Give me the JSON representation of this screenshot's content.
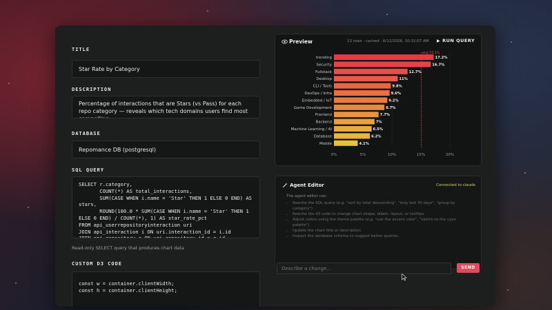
{
  "left": {
    "title_label": "TITLE",
    "title_value": "Star Rate by Category",
    "description_label": "DESCRIPTION",
    "description_value": "Percentage of interactions that are Stars (vs Pass) for each repo category — reveals which tech domains users find most compelling",
    "database_label": "DATABASE",
    "database_value": "Repomance DB (postgresql)",
    "sql_label": "SQL QUERY",
    "sql_value": "SELECT r.category,\n       COUNT(*) AS total_interactions,\n       SUM(CASE WHEN i.name = 'Star' THEN 1 ELSE 0 END) AS\nstars,\n       ROUND(100.0 * SUM(CASE WHEN i.name = 'Star' THEN 1\nELSE 0 END) / COUNT(*), 1) AS star_rate_pct\nFROM api_userrepositoryinteraction uri\nJOIN api_interaction i ON uri.interaction_id = i.id\nJOIN api_repository r ON uri.repository_id = r.id\nGROUP BY r.category\nHAVING COUNT(*) > 50",
    "sql_hint": "Read-only SELECT query that produces chart data",
    "d3_label": "CUSTOM D3 CODE",
    "d3_value": "const w = container.clientWidth;\nconst h = container.clientHeight;"
  },
  "preview": {
    "title": "Preview",
    "meta": "13 rows · cached · 6/12/2026, 10:32:07 AM",
    "run_label": "RUN QUERY"
  },
  "chart_data": {
    "type": "bar",
    "orientation": "horizontal",
    "categories": [
      "trending",
      "Security",
      "Fullstack",
      "Desktop",
      "CLI / Tools",
      "DevOps / Infra",
      "Embedded / IoT",
      "Game Development",
      "Frontend",
      "Backend",
      "Machine Learning / AI",
      "Database",
      "Mobile"
    ],
    "values": [
      17.2,
      16.7,
      12.7,
      11,
      9.8,
      9.6,
      9.2,
      8.7,
      7.7,
      7,
      6.5,
      6.2,
      4.1
    ],
    "value_labels": [
      "17.2%",
      "16.7%",
      "12.7%",
      "11%",
      "9.8%",
      "9.6%",
      "9.2%",
      "8.7%",
      "7.7%",
      "7%",
      "6.5%",
      "6.2%",
      "4.1%"
    ],
    "x_ticks": [
      "0%",
      "5%",
      "10%",
      "15%",
      "20%"
    ],
    "xlim": [
      0,
      20
    ],
    "reference_line": {
      "value": 15.1,
      "label": "avg 15.1%"
    },
    "colors": {
      "start": "#e8364a",
      "end": "#e8c23c",
      "reference": "#e14a5a"
    }
  },
  "agent": {
    "title": "Agent Editor",
    "status": "Connected to claude",
    "intro": "The agent editor can:",
    "items": [
      "Rewrite the SQL query (e.g. \"sort by total descending\", \"only last 30 days\", \"group by category\")",
      "Rewrite the d3 code to change chart shape, labels, layout, or tooltips",
      "Adjust colors using the theme palette (e.g. \"use the accent color\", \"switch to the cyan palette\")",
      "Update the chart title or description",
      "Inspect the database schema to suggest better queries."
    ],
    "input_placeholder": "Describe a change...",
    "send_label": "SEND"
  }
}
